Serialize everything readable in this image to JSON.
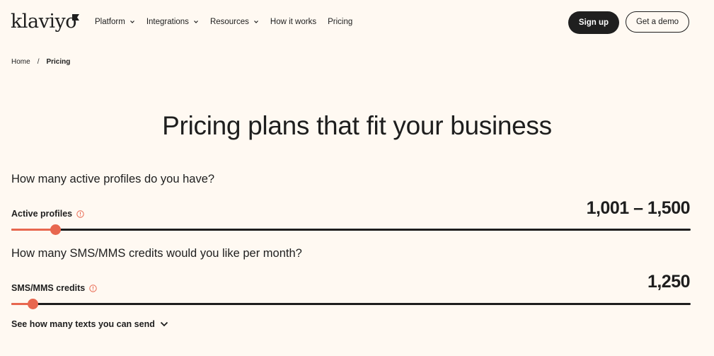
{
  "brand": {
    "logo_text": "klaviyo",
    "accent": "#e8674f",
    "dark": "#1f1f1f",
    "background": "#fff9f2"
  },
  "nav": {
    "items": [
      {
        "label": "Platform",
        "has_dropdown": true
      },
      {
        "label": "Integrations",
        "has_dropdown": true
      },
      {
        "label": "Resources",
        "has_dropdown": true
      },
      {
        "label": "How it works",
        "has_dropdown": false
      },
      {
        "label": "Pricing",
        "has_dropdown": false
      }
    ],
    "signup_label": "Sign up",
    "demo_label": "Get a demo"
  },
  "breadcrumb": {
    "home": "Home",
    "separator": "/",
    "current": "Pricing"
  },
  "page_title": "Pricing plans that fit your business",
  "profiles": {
    "question": "How many active profiles do you have?",
    "label": "Active profiles",
    "value": "1,001 – 1,500",
    "slider_fraction": 0.065
  },
  "sms": {
    "question": "How many SMS/MMS credits would you like per month?",
    "label": "SMS/MMS credits",
    "value": "1,250",
    "slider_fraction": 0.031
  },
  "see_more": "See how many texts you can send"
}
